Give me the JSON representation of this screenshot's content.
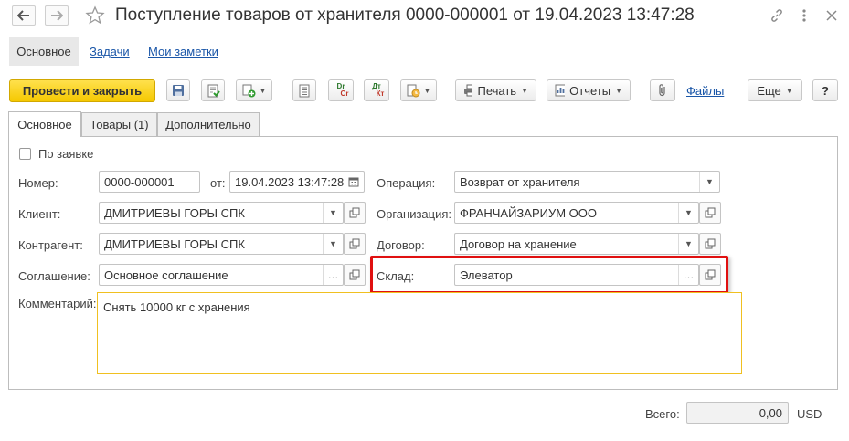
{
  "window": {
    "title": "Поступление товаров от хранителя 0000-000001 от 19.04.2023 13:47:28"
  },
  "nav": {
    "main": "Основное",
    "tasks": "Задачи",
    "notes": "Мои заметки"
  },
  "toolbar": {
    "post_close": "Провести и закрыть",
    "print": "Печать",
    "reports": "Отчеты",
    "files": "Файлы",
    "more": "Еще",
    "help": "?",
    "dr_top": "Dr",
    "dr_bottom": "Cr",
    "dt_top": "Дт",
    "dt_bottom": "Кт"
  },
  "tabs": [
    {
      "label": "Основное",
      "active": true
    },
    {
      "label": "Товары (1)",
      "active": false
    },
    {
      "label": "Дополнительно",
      "active": false
    }
  ],
  "form": {
    "by_request": {
      "label": "По заявке",
      "checked": false
    },
    "number": {
      "label": "Номер:",
      "value": "0000-000001"
    },
    "from": {
      "label": "от:",
      "value": "19.04.2023 13:47:28"
    },
    "operation": {
      "label": "Операция:",
      "value": "Возврат от хранителя"
    },
    "client": {
      "label": "Клиент:",
      "value": "ДМИТРИЕВЫ ГОРЫ СПК"
    },
    "organization": {
      "label": "Организация:",
      "value": "ФРАНЧАЙЗАРИУМ ООО"
    },
    "counterparty": {
      "label": "Контрагент:",
      "value": "ДМИТРИЕВЫ ГОРЫ СПК"
    },
    "contract": {
      "label": "Договор:",
      "value": "Договор на хранение"
    },
    "agreement": {
      "label": "Соглашение:",
      "value": "Основное соглашение"
    },
    "warehouse": {
      "label": "Склад:",
      "value": "Элеватор"
    },
    "comment": {
      "label": "Комментарий:",
      "value": "Снять 10000 кг с хранения"
    }
  },
  "footer": {
    "total_label": "Всего:",
    "total_value": "0,00",
    "currency": "USD"
  },
  "colors": {
    "primary": "#f5c800",
    "highlight": "#e01010",
    "comment_border": "#f0c020",
    "link": "#1a56a8"
  }
}
